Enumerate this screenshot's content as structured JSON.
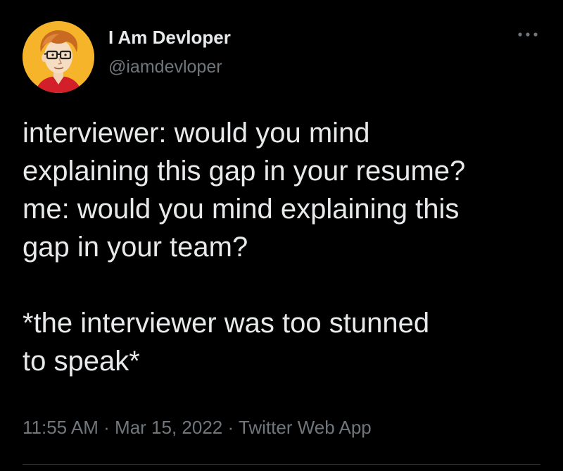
{
  "user": {
    "display_name": "I Am Devloper",
    "handle": "@iamdevloper",
    "avatar": "cartoon-developer-avatar"
  },
  "tweet": {
    "text": "interviewer: would you mind\nexplaining this gap in your resume?\nme: would you mind explaining this\ngap in your team?\n\n*the interviewer was too stunned\nto speak*"
  },
  "meta": {
    "time": "11:55 AM",
    "separator": " · ",
    "date": "Mar 15, 2022",
    "source": "Twitter Web App"
  },
  "icons": {
    "more": "more-horizontal-icon"
  },
  "colors": {
    "background": "#000000",
    "text_primary": "#e7e9ea",
    "text_secondary": "#71767b",
    "avatar_bg": "#f6b42a"
  }
}
